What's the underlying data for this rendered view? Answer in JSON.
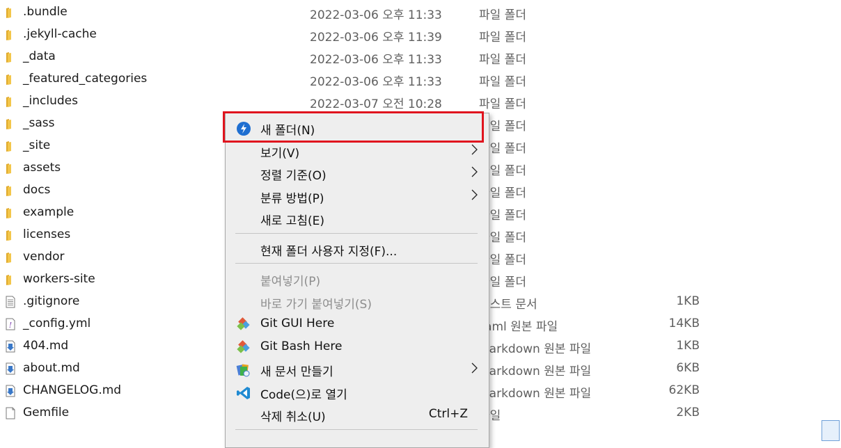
{
  "files": [
    {
      "name": ".bundle",
      "date": "2022-03-06 오후 11:33",
      "type": "파일 폴더",
      "size": "",
      "icon": "folder"
    },
    {
      "name": ".jekyll-cache",
      "date": "2022-03-06 오후 11:39",
      "type": "파일 폴더",
      "size": "",
      "icon": "folder"
    },
    {
      "name": "_data",
      "date": "2022-03-06 오후 11:33",
      "type": "파일 폴더",
      "size": "",
      "icon": "folder"
    },
    {
      "name": "_featured_categories",
      "date": "2022-03-06 오후 11:33",
      "type": "파일 폴더",
      "size": "",
      "icon": "folder"
    },
    {
      "name": "_includes",
      "date": "2022-03-07 오전 10:28",
      "type": "파일 폴더",
      "size": "",
      "icon": "folder"
    },
    {
      "name": "_sass",
      "date": "",
      "type": "파일 폴더",
      "size": "",
      "icon": "folder"
    },
    {
      "name": "_site",
      "date": "",
      "type": "파일 폴더",
      "size": "",
      "icon": "folder"
    },
    {
      "name": "assets",
      "date": "",
      "type": "파일 폴더",
      "size": "",
      "icon": "folder"
    },
    {
      "name": "docs",
      "date": "",
      "type": "파일 폴더",
      "size": "",
      "icon": "folder"
    },
    {
      "name": "example",
      "date": "",
      "type": "파일 폴더",
      "size": "",
      "icon": "folder"
    },
    {
      "name": "licenses",
      "date": "",
      "type": "파일 폴더",
      "size": "",
      "icon": "folder"
    },
    {
      "name": "vendor",
      "date": "",
      "type": "파일 폴더",
      "size": "",
      "icon": "folder"
    },
    {
      "name": "workers-site",
      "date": "",
      "type": "파일 폴더",
      "size": "",
      "icon": "folder"
    },
    {
      "name": ".gitignore",
      "date": "",
      "type": "텍스트 문서",
      "size": "1KB",
      "icon": "text-file"
    },
    {
      "name": "_config.yml",
      "date": "",
      "type": "Yaml 원본 파일",
      "size": "14KB",
      "icon": "yaml-file"
    },
    {
      "name": "404.md",
      "date": "",
      "type": "Markdown 원본 파일",
      "size": "1KB",
      "icon": "markdown-file"
    },
    {
      "name": "about.md",
      "date": "",
      "type": "Markdown 원본 파일",
      "size": "6KB",
      "icon": "markdown-file"
    },
    {
      "name": "CHANGELOG.md",
      "date": "",
      "type": "Markdown 원본 파일",
      "size": "62KB",
      "icon": "markdown-file"
    },
    {
      "name": "Gemfile",
      "date": "",
      "type": "파일",
      "size": "2KB",
      "icon": "blank-file"
    }
  ],
  "context_menu": {
    "items": [
      {
        "label": "새 폴더(N)",
        "icon": "new-folder-icon",
        "submenu": false,
        "disabled": false,
        "highlighted": true
      },
      {
        "label": "보기(V)",
        "icon": "",
        "submenu": true,
        "disabled": false
      },
      {
        "label": "정렬 기준(O)",
        "icon": "",
        "submenu": true,
        "disabled": false
      },
      {
        "label": "분류 방법(P)",
        "icon": "",
        "submenu": true,
        "disabled": false
      },
      {
        "label": "새로 고침(E)",
        "icon": "",
        "submenu": false,
        "disabled": false
      },
      {
        "separator": true
      },
      {
        "label": "현재 폴더 사용자 지정(F)...",
        "icon": "",
        "submenu": false,
        "disabled": false
      },
      {
        "separator": true
      },
      {
        "label": "붙여넣기(P)",
        "icon": "",
        "submenu": false,
        "disabled": true
      },
      {
        "label": "바로 가기 붙여넣기(S)",
        "icon": "",
        "submenu": false,
        "disabled": true
      },
      {
        "label": "Git GUI Here",
        "icon": "git-gui-icon",
        "submenu": false,
        "disabled": false
      },
      {
        "label": "Git Bash Here",
        "icon": "git-bash-icon",
        "submenu": false,
        "disabled": false
      },
      {
        "label": "새 문서 만들기",
        "icon": "new-document-icon",
        "submenu": true,
        "disabled": false
      },
      {
        "label": "Code(으)로 열기",
        "icon": "vscode-icon",
        "submenu": false,
        "disabled": false
      },
      {
        "label": "삭제 취소(U)",
        "icon": "",
        "submenu": false,
        "disabled": false,
        "shortcut": "Ctrl+Z"
      },
      {
        "separator": true
      }
    ]
  },
  "colors": {
    "highlight_border": "#e0141e",
    "menu_background": "#eeeeee",
    "folder_yellow": "#f3c64a"
  }
}
